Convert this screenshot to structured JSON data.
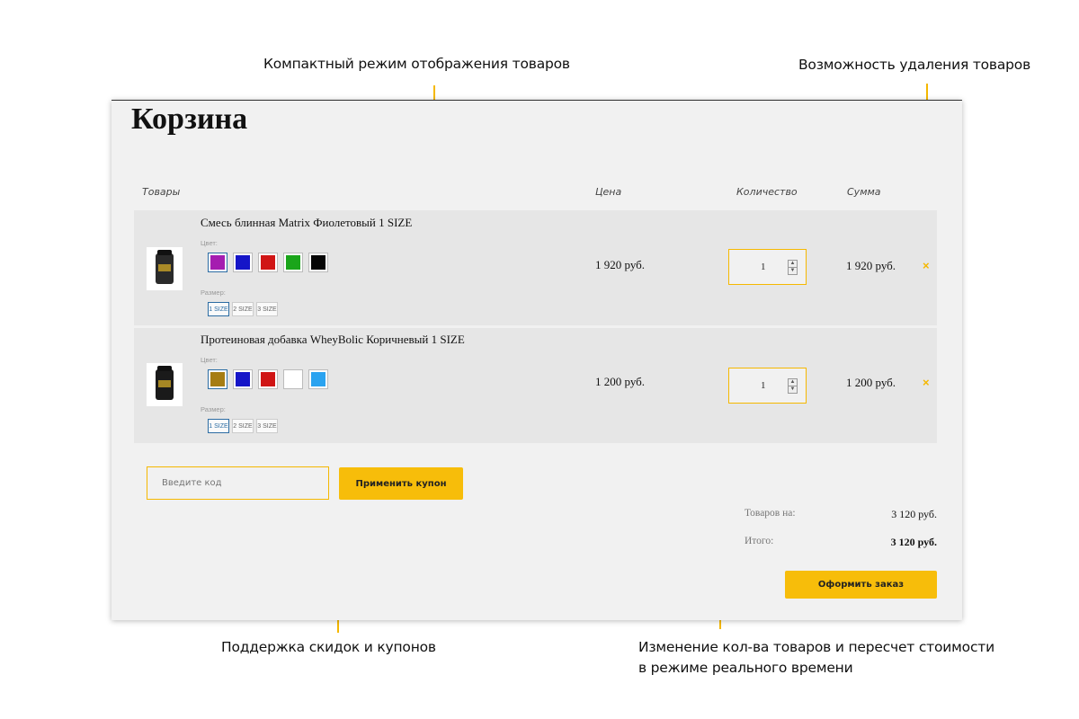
{
  "annotations": {
    "compact": "Компактный режим отображения товаров",
    "remove": "Возможность удаления товаров",
    "coupons": "Поддержка скидок и купонов",
    "realtime_line1": "Изменение кол-ва товаров и пересчет стоимости",
    "realtime_line2": "в режиме реального времени"
  },
  "cart": {
    "title": "Корзина",
    "columns": {
      "products": "Товары",
      "price": "Цена",
      "quantity": "Количество",
      "sum": "Сумма"
    },
    "color_label": "Цвет:",
    "size_label": "Размер:",
    "items": [
      {
        "name": "Смесь блинная Matrix Фиолетовый 1 SIZE",
        "thumb_color": "#2a2a2a",
        "colors": [
          "#a51db0",
          "#1515c8",
          "#d01515",
          "#1aa51a",
          "#050505"
        ],
        "selected_color": 0,
        "sizes": [
          "1 SIZE",
          "2 SIZE",
          "3 SIZE"
        ],
        "selected_size": 0,
        "price": "1 920 руб.",
        "quantity": "1",
        "sum": "1 920 руб.",
        "remove_icon": "×"
      },
      {
        "name": "Протеиновая добавка WheyBolic Коричневый 1 SIZE",
        "thumb_color": "#1a1a1a",
        "colors": [
          "#a67d13",
          "#1515c8",
          "#d01515",
          "#ffffff",
          "#2aa3f0"
        ],
        "selected_color": 0,
        "sizes": [
          "1 SIZE",
          "2 SIZE",
          "3 SIZE"
        ],
        "selected_size": 0,
        "price": "1 200 руб.",
        "quantity": "1",
        "sum": "1 200 руб.",
        "remove_icon": "×"
      }
    ],
    "coupon": {
      "placeholder": "Введите код",
      "button": "Применить купон"
    },
    "totals": {
      "items_label": "Товаров на:",
      "items_value": "3 120 руб.",
      "total_label": "Итого:",
      "total_value": "3 120 руб."
    },
    "checkout_button": "Оформить заказ"
  },
  "colors": {
    "accent": "#f5b800",
    "button": "#f7bd0a",
    "panel": "#f1f1f1",
    "row": "#e6e6e6",
    "selected_border": "#2b6ca3"
  }
}
